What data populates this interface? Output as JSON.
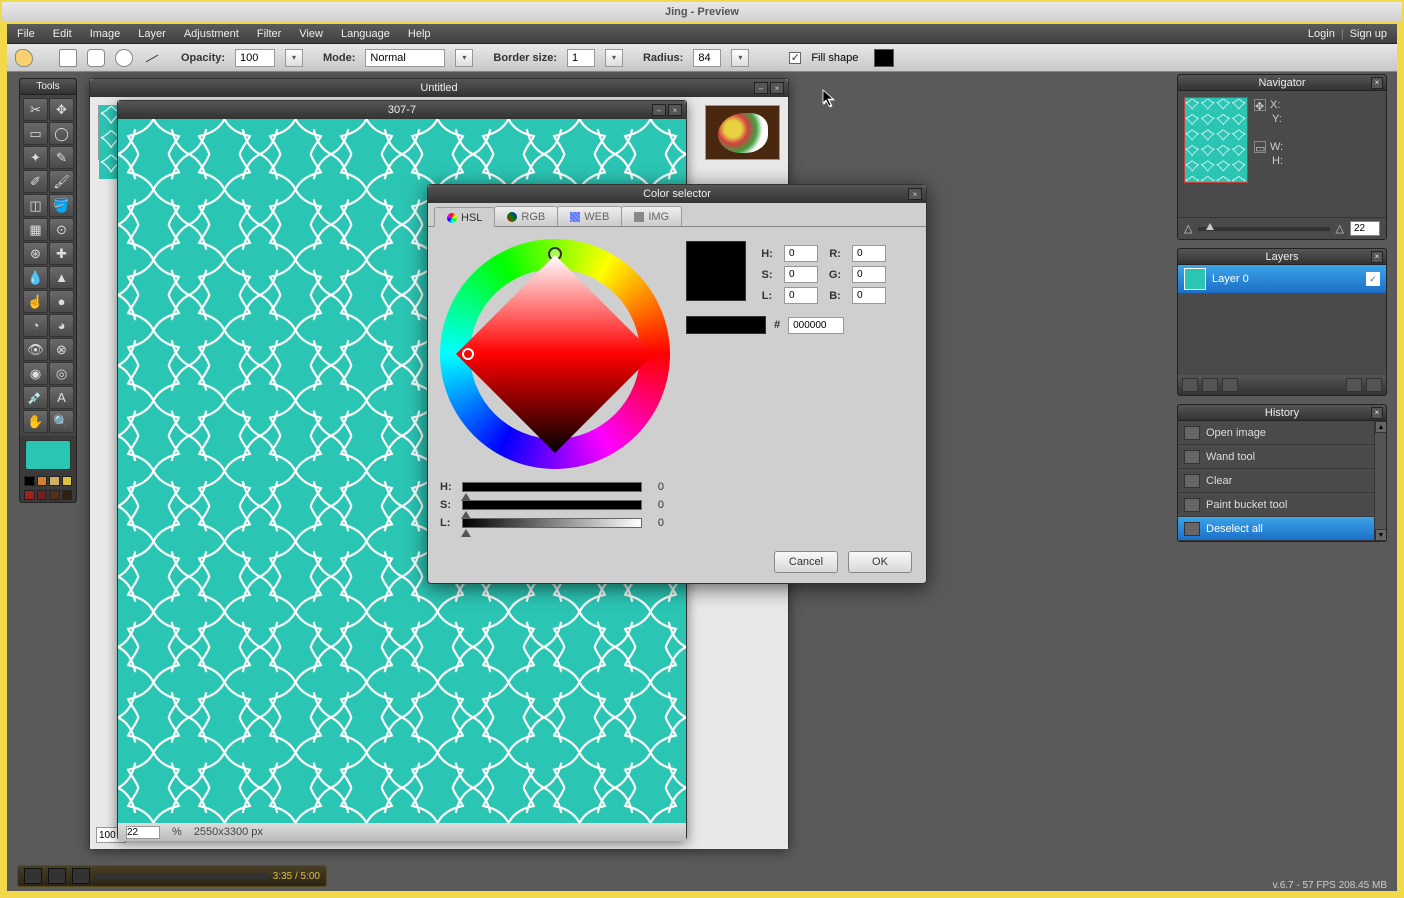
{
  "window_title": "Jing - Preview",
  "menubar": {
    "items": [
      "File",
      "Edit",
      "Image",
      "Layer",
      "Adjustment",
      "Filter",
      "View",
      "Language",
      "Help"
    ],
    "login": "Login",
    "signup": "Sign up",
    "sep": "|"
  },
  "options": {
    "opacity_label": "Opacity:",
    "opacity_value": "100",
    "mode_label": "Mode:",
    "mode_value": "Normal",
    "border_label": "Border size:",
    "border_value": "1",
    "radius_label": "Radius:",
    "radius_value": "84",
    "fill_shape_label": "Fill shape",
    "fill_shape_checked": "✓"
  },
  "tools": {
    "title": "Tools"
  },
  "doc_untitled": {
    "title": "Untitled",
    "left_opacity": "100"
  },
  "doc_307": {
    "title": "307-7",
    "zoom_value": "22",
    "zoom_suffix": "%",
    "dimensions": "2550x3300 px"
  },
  "color_dialog": {
    "title": "Color selector",
    "tabs": {
      "hsl": "HSL",
      "rgb": "RGB",
      "web": "WEB",
      "img": "IMG"
    },
    "fields": {
      "H": "0",
      "S": "0",
      "L": "0",
      "R": "0",
      "G": "0",
      "B": "0",
      "hex": "000000"
    },
    "sliders": {
      "H": "0",
      "S": "0",
      "L": "0"
    },
    "buttons": {
      "cancel": "Cancel",
      "ok": "OK"
    }
  },
  "navigator": {
    "title": "Navigator",
    "labels": {
      "x": "X:",
      "y": "Y:",
      "w": "W:",
      "h": "H:"
    },
    "zoom_value": "22"
  },
  "layers": {
    "title": "Layers",
    "items": [
      {
        "name": "Layer 0"
      }
    ]
  },
  "history": {
    "title": "History",
    "items": [
      "Open image",
      "Wand tool",
      "Clear",
      "Paint bucket tool",
      "Deselect all"
    ]
  },
  "status_footer": "v.6.7 - 57 FPS 208.45 MB",
  "player": {
    "time": "3:35 / 5:00"
  },
  "colors": {
    "teal": "#2bc5b4",
    "_note": "primary accent teal used across canvas/thumbnails"
  }
}
